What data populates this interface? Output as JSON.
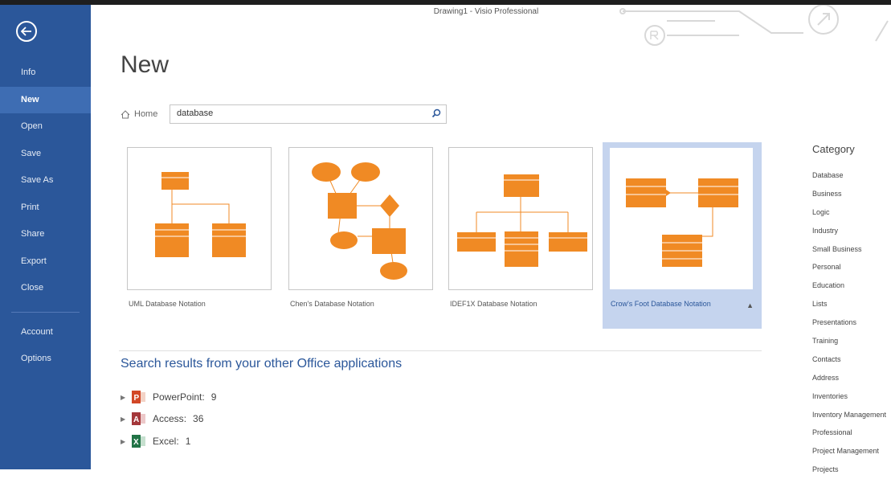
{
  "window": {
    "title": "Drawing1 - Visio Professional"
  },
  "sidebar": {
    "items": [
      {
        "label": "Info"
      },
      {
        "label": "New"
      },
      {
        "label": "Open"
      },
      {
        "label": "Save"
      },
      {
        "label": "Save As"
      },
      {
        "label": "Print"
      },
      {
        "label": "Share"
      },
      {
        "label": "Export"
      },
      {
        "label": "Close"
      }
    ],
    "bottom_items": [
      {
        "label": "Account"
      },
      {
        "label": "Options"
      }
    ],
    "active": "New"
  },
  "main": {
    "title": "New",
    "home_label": "Home",
    "search_value": "database",
    "templates": [
      {
        "label": "UML Database Notation"
      },
      {
        "label": "Chen's Database Notation"
      },
      {
        "label": "IDEF1X Database Notation"
      },
      {
        "label": "Crow's Foot Database Notation",
        "selected": true
      }
    ],
    "results_heading": "Search results from your other Office applications",
    "results": [
      {
        "app": "PowerPoint",
        "count": "9",
        "icon": "powerpoint-icon",
        "color": "#d24726"
      },
      {
        "app": "Access",
        "count": "36",
        "icon": "access-icon",
        "color": "#a4373a"
      },
      {
        "app": "Excel",
        "count": "1",
        "icon": "excel-icon",
        "color": "#217346"
      }
    ]
  },
  "category": {
    "heading": "Category",
    "items": [
      "Database",
      "Business",
      "Logic",
      "Industry",
      "Small Business",
      "Personal",
      "Education",
      "Lists",
      "Presentations",
      "Training",
      "Contacts",
      "Address",
      "Inventories",
      "Inventory Management",
      "Professional",
      "Project Management",
      "Projects"
    ]
  },
  "colors": {
    "accent": "#2b579a",
    "shape": "#f08a24",
    "selected_tile": "#c5d4ee"
  }
}
